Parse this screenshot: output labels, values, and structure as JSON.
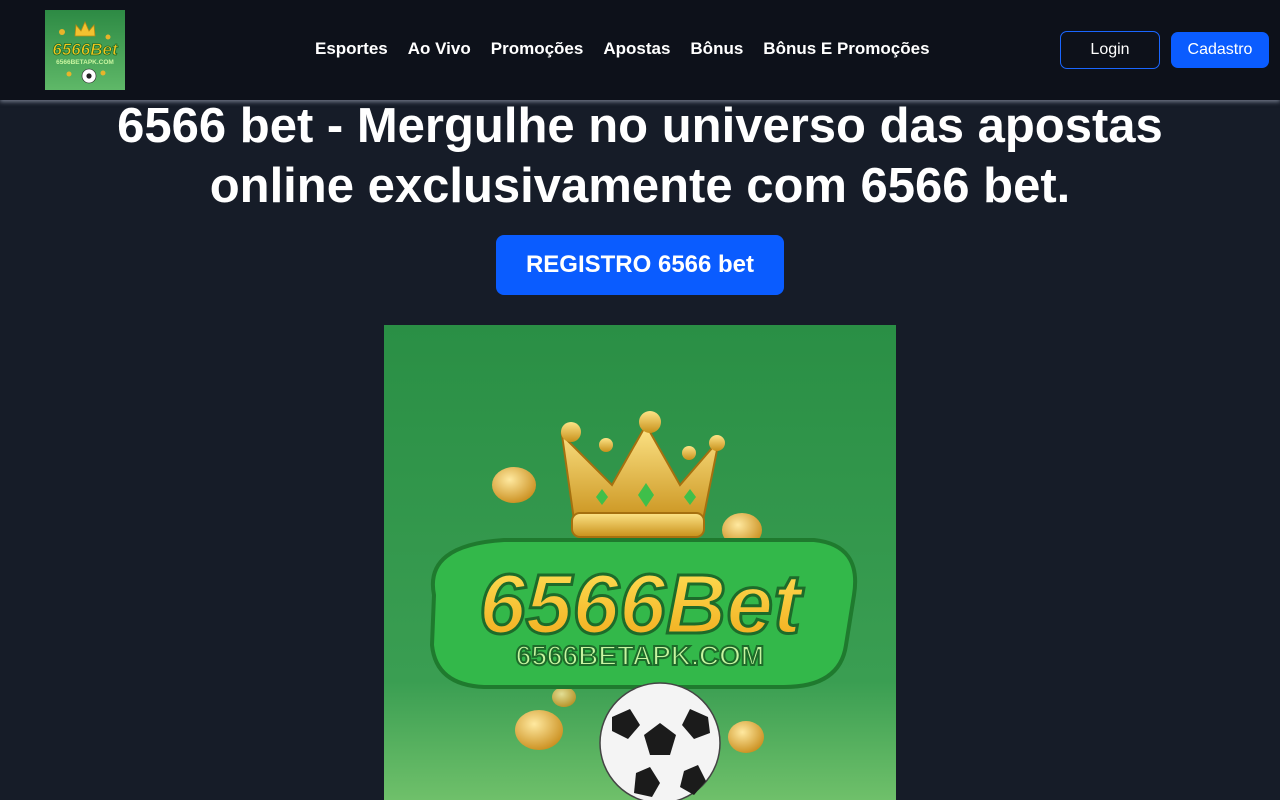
{
  "header": {
    "logo_brand": "6566Bet",
    "logo_domain": "6566BETAPK.COM",
    "nav": [
      "Esportes",
      "Ao Vivo",
      "Promoções",
      "Apostas",
      "Bônus",
      "Bônus E Promoções"
    ],
    "login_label": "Login",
    "signup_label": "Cadastro"
  },
  "hero": {
    "title_line1": "6566 bet - Mergulhe no universo das apostas",
    "title_line2": "online exclusivamente com 6566 bet.",
    "register_label": "REGISTRO 6566 bet"
  },
  "banner": {
    "brand": "6566Bet",
    "domain": "6566BETAPK.COM"
  },
  "colors": {
    "page_bg": "#161c28",
    "header_bg": "#0d111a",
    "accent_blue": "#0a5cff",
    "banner_green": "#2a8f45",
    "brand_yellow": "#f5c81c"
  }
}
